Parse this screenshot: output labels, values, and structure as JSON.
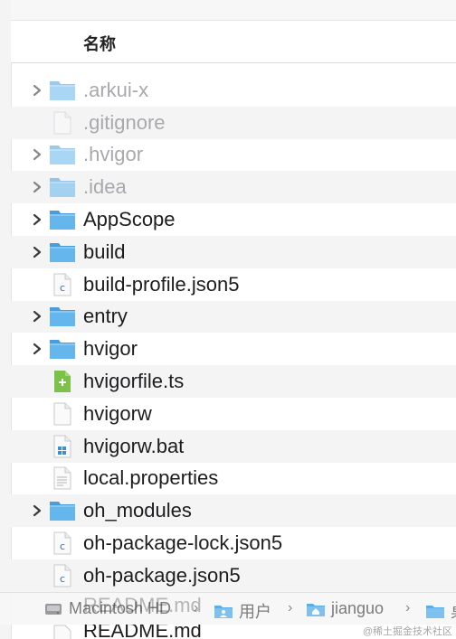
{
  "header": {
    "column_name": "名称"
  },
  "files": [
    {
      "label": ".arkui-x",
      "type": "folder",
      "expandable": true,
      "hidden": true,
      "icon": "folder-icon"
    },
    {
      "label": ".gitignore",
      "type": "file",
      "expandable": false,
      "hidden": true,
      "icon": "blank-file-icon"
    },
    {
      "label": ".hvigor",
      "type": "folder",
      "expandable": true,
      "hidden": true,
      "icon": "folder-icon"
    },
    {
      "label": ".idea",
      "type": "folder",
      "expandable": true,
      "hidden": true,
      "icon": "folder-icon"
    },
    {
      "label": "AppScope",
      "type": "folder",
      "expandable": true,
      "hidden": false,
      "icon": "folder-icon"
    },
    {
      "label": "build",
      "type": "folder",
      "expandable": true,
      "hidden": false,
      "icon": "folder-icon"
    },
    {
      "label": "build-profile.json5",
      "type": "file",
      "expandable": false,
      "hidden": false,
      "icon": "c-file-icon"
    },
    {
      "label": "entry",
      "type": "folder",
      "expandable": true,
      "hidden": false,
      "icon": "folder-icon"
    },
    {
      "label": "hvigor",
      "type": "folder",
      "expandable": true,
      "hidden": false,
      "icon": "folder-icon"
    },
    {
      "label": "hvigorfile.ts",
      "type": "file",
      "expandable": false,
      "hidden": false,
      "icon": "ts-file-icon"
    },
    {
      "label": "hvigorw",
      "type": "file",
      "expandable": false,
      "hidden": false,
      "icon": "blank-file-icon"
    },
    {
      "label": "hvigorw.bat",
      "type": "file",
      "expandable": false,
      "hidden": false,
      "icon": "bat-file-icon"
    },
    {
      "label": "local.properties",
      "type": "file",
      "expandable": false,
      "hidden": false,
      "icon": "text-file-icon"
    },
    {
      "label": "oh_modules",
      "type": "folder",
      "expandable": true,
      "hidden": false,
      "icon": "folder-icon"
    },
    {
      "label": "oh-package-lock.json5",
      "type": "file",
      "expandable": false,
      "hidden": false,
      "icon": "c-file-icon"
    },
    {
      "label": "oh-package.json5",
      "type": "file",
      "expandable": false,
      "hidden": false,
      "icon": "c-file-icon"
    }
  ],
  "overlay_text": "README.md",
  "bottom_item": {
    "label": "README.md"
  },
  "path_bar": {
    "segments": [
      {
        "label": "Macintosh HD",
        "icon": "disk-icon"
      },
      {
        "label": "用户",
        "icon": "users-folder-icon"
      },
      {
        "label": "jianguo",
        "icon": "home-folder-icon"
      },
      {
        "label": "桌",
        "icon": "folder-icon"
      }
    ],
    "separator": "›"
  },
  "watermark": "@稀土掘金技术社区",
  "colors": {
    "folder": "#5aaee8",
    "folder_tab": "#4a9ddc",
    "hidden_text": "#a9a9ad",
    "text": "#1d1d1f",
    "alt_row": "#f4f4f5",
    "ts_icon": "#7cc24a"
  }
}
